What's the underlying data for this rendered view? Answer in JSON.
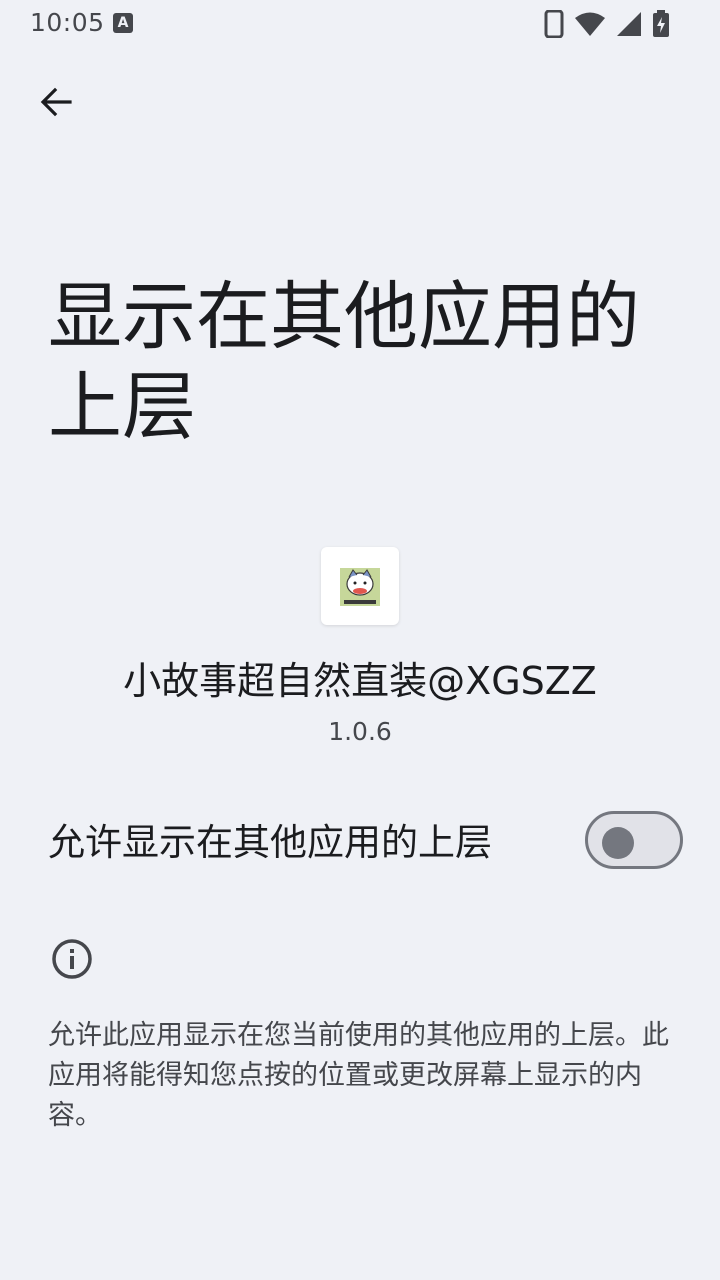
{
  "status_bar": {
    "time": "10:05",
    "a_badge": "A",
    "icons": [
      "phone-icon",
      "wifi-icon",
      "signal-icon",
      "battery-charging-icon"
    ]
  },
  "header": {
    "back_icon": "arrow-left-icon",
    "title": "显示在其他应用的上层"
  },
  "app": {
    "name": "小故事超自然直装@XGSZZ",
    "version": "1.0.6",
    "icon": "app-icon"
  },
  "permission": {
    "toggle_label": "允许显示在其他应用的上层",
    "enabled": false
  },
  "info": {
    "icon": "info-icon",
    "text": "允许此应用显示在您当前使用的其他应用的上层。此应用将能得知您点按的位置或更改屏幕上显示的内容。"
  },
  "colors": {
    "background": "#eff1f6",
    "text_primary": "#1b1c1f",
    "text_secondary": "#45474c",
    "switch_outline": "#74777f",
    "switch_track": "#e1e2e8"
  }
}
